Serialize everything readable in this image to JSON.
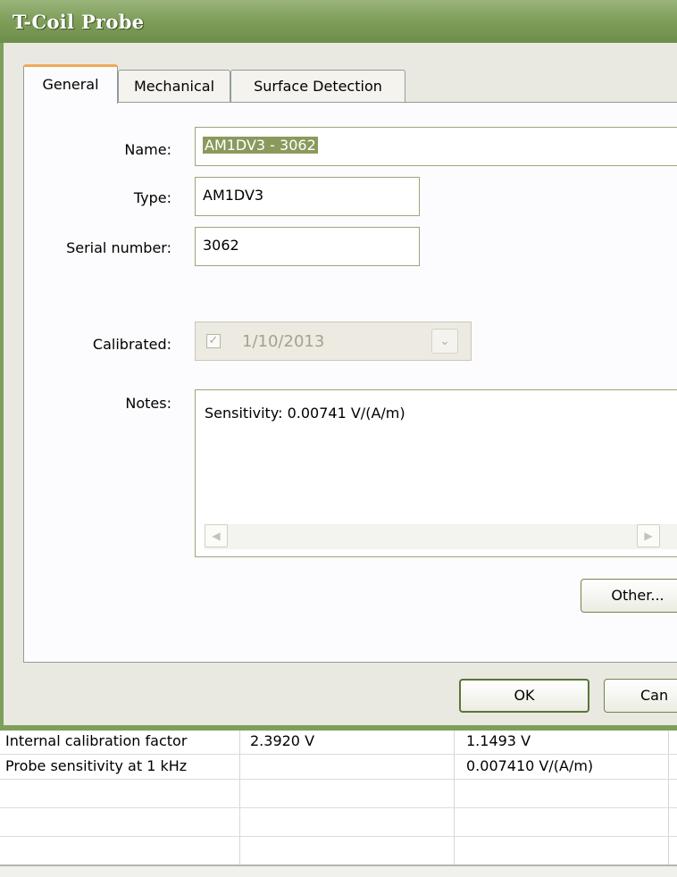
{
  "dialog": {
    "title": "T-Coil Probe",
    "tabs": [
      {
        "label": "General",
        "active": true
      },
      {
        "label": "Mechanical",
        "active": false
      },
      {
        "label": "Surface Detection",
        "active": false
      }
    ],
    "fields": {
      "name_label": "Name:",
      "name_value": "AM1DV3 - 3062",
      "type_label": "Type:",
      "type_value": "AM1DV3",
      "serial_label": "Serial number:",
      "serial_value": "3062",
      "calibrated_label": "Calibrated:",
      "calibrated_checked": true,
      "calibrated_date": "1/10/2013",
      "notes_label": "Notes:",
      "notes_value": "Sensitivity: 0.00741 V/(A/m)"
    },
    "buttons": {
      "other": "Other...",
      "ok": "OK",
      "cancel": "Can"
    },
    "icons": {
      "check": "✓",
      "dropdown": "chevron-down-icon",
      "scroll_left": "arrow-left-icon",
      "scroll_right": "arrow-right-icon"
    }
  },
  "table": {
    "rows": [
      [
        "Internal calibration factor",
        "2.3920 V",
        "1.1493 V"
      ],
      [
        "Probe sensitivity at 1 kHz",
        "",
        "0.007410 V/(A/m)"
      ],
      [
        "",
        "",
        ""
      ],
      [
        "",
        "",
        ""
      ]
    ]
  }
}
